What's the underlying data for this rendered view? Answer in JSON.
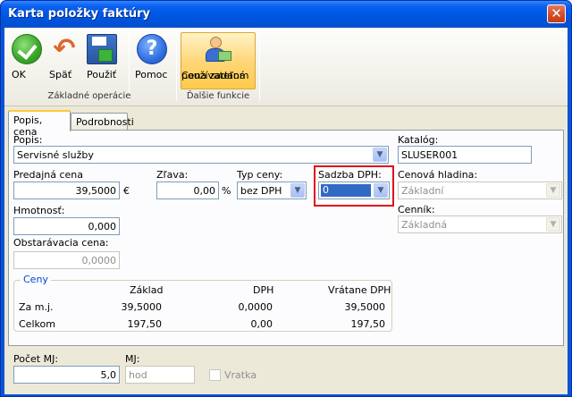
{
  "window": {
    "title": "Karta položky faktúry",
    "close_glyph": "✕"
  },
  "ribbon": {
    "buttons": [
      {
        "label": "OK",
        "icon": "ok-check-icon"
      },
      {
        "label": "Späť",
        "icon": "back-arrow-icon"
      },
      {
        "label": "Použiť",
        "icon": "save-disk-icon"
      },
      {
        "label": "Pomoc",
        "icon": "help-icon"
      },
      {
        "label": "Cena zadaná používateľom",
        "label_line1": "Cena zadaná",
        "label_line2": "používateľom",
        "icon": "user-price-icon",
        "active": true
      }
    ],
    "groups": [
      {
        "label": "Základné operácie"
      },
      {
        "label": "Ďalšie funkcie"
      }
    ]
  },
  "tabs": [
    {
      "label": "Popis, cena",
      "active": true
    },
    {
      "label": "Podrobnosti",
      "active": false
    }
  ],
  "form": {
    "popis": {
      "label": "Popis:",
      "value": "Servisné služby"
    },
    "katalog": {
      "label": "Katalóg:",
      "value": "SLUSER001"
    },
    "predajna_cena": {
      "label": "Predajná cena",
      "value": "39,5000",
      "unit": "€"
    },
    "zlava": {
      "label": "Zľava:",
      "value": "0,00",
      "unit": "%"
    },
    "typ_ceny": {
      "label": "Typ ceny:",
      "value": "bez DPH"
    },
    "sadzba_dph": {
      "label": "Sadzba DPH:",
      "value": "0"
    },
    "cenova_hladina": {
      "label": "Cenová hladina:",
      "value": "Základní"
    },
    "cennik": {
      "label": "Cenník:",
      "value": "Základná"
    },
    "hmotnost": {
      "label": "Hmotnosť:",
      "value": "0,000"
    },
    "obstaravacia_cena": {
      "label": "Obstarávacia cena:",
      "value": "0,0000"
    }
  },
  "ceny": {
    "title": "Ceny",
    "headers": [
      "",
      "Základ",
      "DPH",
      "Vrátane DPH"
    ],
    "rows": [
      {
        "label": "Za m.j.",
        "zaklad": "39,5000",
        "dph": "0,0000",
        "vratane": "39,5000"
      },
      {
        "label": "Celkom",
        "zaklad": "197,50",
        "dph": "0,00",
        "vratane": "197,50"
      }
    ]
  },
  "bottom": {
    "pocet_mj": {
      "label": "Počet MJ:",
      "value": "5,0"
    },
    "mj": {
      "label": "MJ:",
      "value": "hod"
    },
    "vratka": {
      "label": "Vratka",
      "checked": false
    }
  },
  "colors": {
    "accent": "#0058e6",
    "highlight": "#316ac5",
    "callout": "#e0101a"
  }
}
